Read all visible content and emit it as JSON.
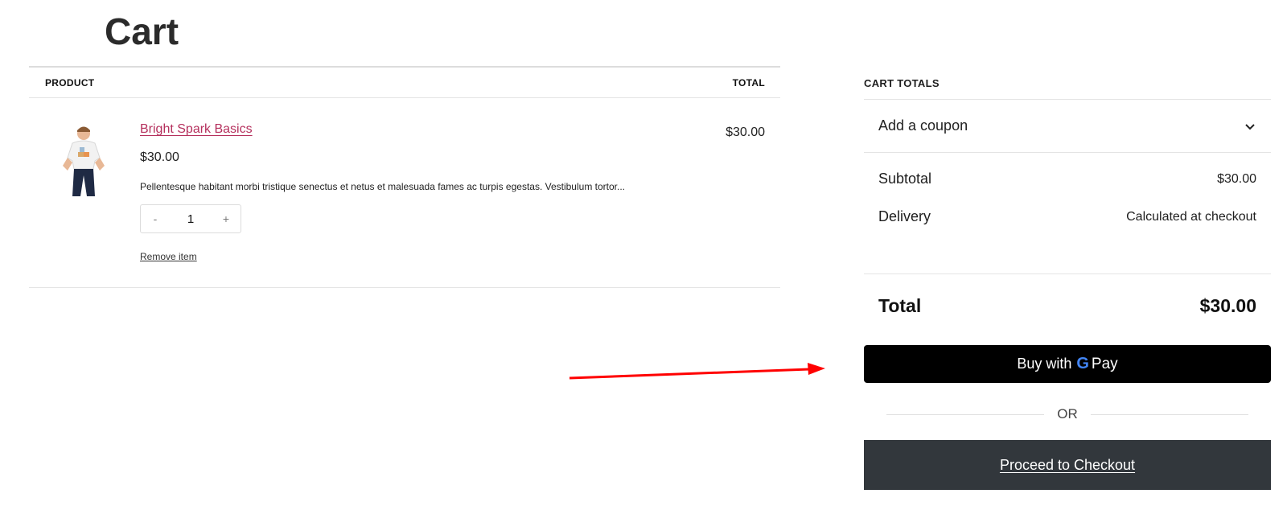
{
  "page": {
    "title": "Cart"
  },
  "table": {
    "header_product": "PRODUCT",
    "header_total": "TOTAL"
  },
  "item": {
    "name": "Bright Spark Basics",
    "price": "$30.00",
    "description": "Pellentesque habitant morbi tristique senectus et netus et malesuada fames ac turpis egestas. Vestibulum tortor...",
    "quantity": "1",
    "qty_minus": "-",
    "qty_plus": "+",
    "remove_label": "Remove item",
    "line_total": "$30.00"
  },
  "totals": {
    "heading": "CART TOTALS",
    "coupon_label": "Add a coupon",
    "subtotal_label": "Subtotal",
    "subtotal_value": "$30.00",
    "delivery_label": "Delivery",
    "delivery_value": "Calculated at checkout",
    "total_label": "Total",
    "total_value": "$30.00"
  },
  "actions": {
    "gpay_prefix": "Buy with",
    "gpay_g": "G",
    "gpay_pay": "Pay",
    "or_label": "OR",
    "checkout_label": "Proceed to Checkout"
  },
  "colors": {
    "link": "#b5305d",
    "checkout_bg": "#32373c",
    "gpay_bg": "#000000",
    "annotation_arrow": "#ff0000"
  }
}
